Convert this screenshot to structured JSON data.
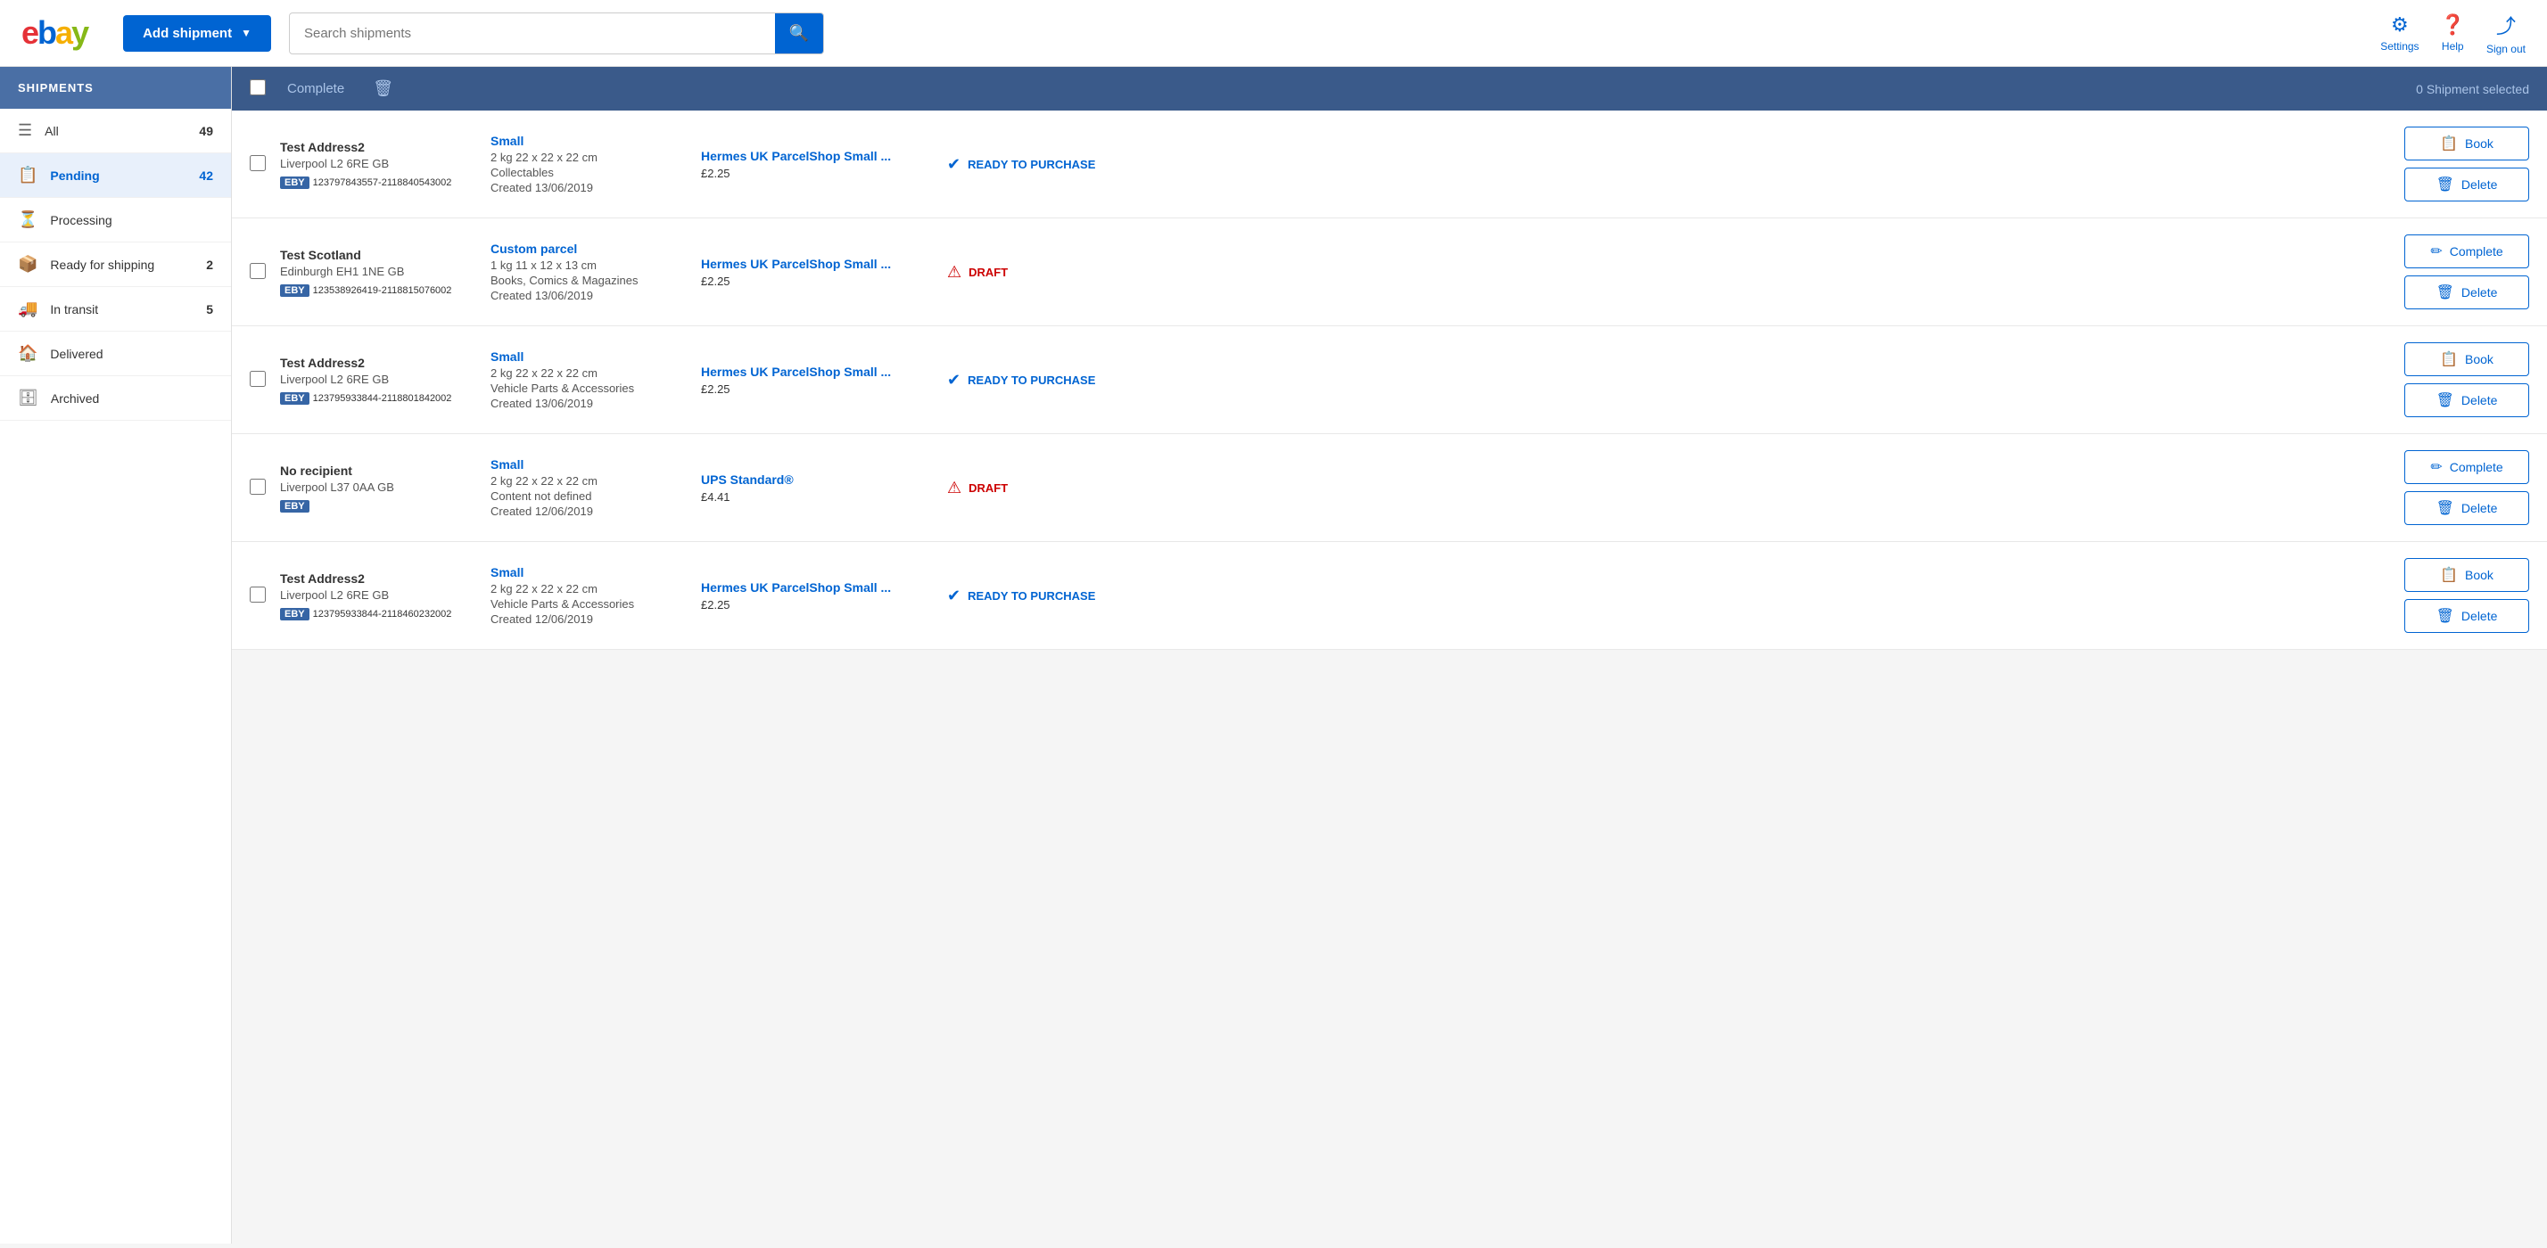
{
  "header": {
    "logo": {
      "e": "e",
      "b": "b",
      "a": "a",
      "y": "y"
    },
    "add_shipment_label": "Add shipment",
    "search_placeholder": "Search shipments",
    "settings_label": "Settings",
    "help_label": "Help",
    "signout_label": "Sign out"
  },
  "sidebar": {
    "title": "SHIPMENTS",
    "items": [
      {
        "id": "all",
        "label": "All",
        "count": "49",
        "icon": "≡"
      },
      {
        "id": "pending",
        "label": "Pending",
        "count": "42",
        "icon": "📋",
        "active": true
      },
      {
        "id": "processing",
        "label": "Processing",
        "count": "",
        "icon": "⏳"
      },
      {
        "id": "ready",
        "label": "Ready for shipping",
        "count": "2",
        "icon": "📦"
      },
      {
        "id": "transit",
        "label": "In transit",
        "count": "5",
        "icon": "🚚"
      },
      {
        "id": "delivered",
        "label": "Delivered",
        "count": "",
        "icon": "🏠"
      },
      {
        "id": "archived",
        "label": "Archived",
        "count": "",
        "icon": "🗄"
      }
    ]
  },
  "toolbar": {
    "complete_label": "Complete",
    "selected_label": "0 Shipment selected"
  },
  "shipments": [
    {
      "id": 1,
      "address_name": "Test Address2",
      "address_city": "Liverpool L2 6RE GB",
      "badge": "EBY",
      "tracking": "123797843557-2118840543002",
      "parcel_type": "Small",
      "parcel_dims": "2 kg 22 x 22 x 22 cm",
      "parcel_category": "Collectables",
      "parcel_date": "Created 13/06/2019",
      "service_name": "Hermes UK ParcelShop Small ...",
      "service_price": "£2.25",
      "status": "ready",
      "status_label": "READY TO PURCHASE",
      "actions": [
        "Book",
        "Delete"
      ]
    },
    {
      "id": 2,
      "address_name": "Test Scotland",
      "address_city": "Edinburgh EH1 1NE GB",
      "badge": "EBY",
      "tracking": "123538926419-2118815076002",
      "parcel_type": "Custom parcel",
      "parcel_dims": "1 kg 11 x 12 x 13 cm",
      "parcel_category": "Books, Comics & Magazines",
      "parcel_date": "Created 13/06/2019",
      "service_name": "Hermes UK ParcelShop Small ...",
      "service_price": "£2.25",
      "status": "draft",
      "status_label": "DRAFT",
      "actions": [
        "Complete",
        "Delete"
      ]
    },
    {
      "id": 3,
      "address_name": "Test Address2",
      "address_city": "Liverpool L2 6RE GB",
      "badge": "EBY",
      "tracking": "123795933844-2118801842002",
      "parcel_type": "Small",
      "parcel_dims": "2 kg 22 x 22 x 22 cm",
      "parcel_category": "Vehicle Parts & Accessories",
      "parcel_date": "Created 13/06/2019",
      "service_name": "Hermes UK ParcelShop Small ...",
      "service_price": "£2.25",
      "status": "ready",
      "status_label": "READY TO PURCHASE",
      "actions": [
        "Book",
        "Delete"
      ]
    },
    {
      "id": 4,
      "address_name": "No recipient",
      "address_city": "Liverpool L37 0AA GB",
      "badge": "EBY",
      "tracking": "",
      "parcel_type": "Small",
      "parcel_dims": "2 kg 22 x 22 x 22 cm",
      "parcel_category": "Content not defined",
      "parcel_date": "Created 12/06/2019",
      "service_name": "UPS Standard®",
      "service_price": "£4.41",
      "status": "draft",
      "status_label": "DRAFT",
      "actions": [
        "Complete",
        "Delete"
      ]
    },
    {
      "id": 5,
      "address_name": "Test Address2",
      "address_city": "Liverpool L2 6RE GB",
      "badge": "EBY",
      "tracking": "123795933844-2118460232002",
      "parcel_type": "Small",
      "parcel_dims": "2 kg 22 x 22 x 22 cm",
      "parcel_category": "Vehicle Parts & Accessories",
      "parcel_date": "Created 12/06/2019",
      "service_name": "Hermes UK ParcelShop Small ...",
      "service_price": "£2.25",
      "status": "ready",
      "status_label": "READY TO PURCHASE",
      "actions": [
        "Book",
        "Delete"
      ]
    }
  ]
}
